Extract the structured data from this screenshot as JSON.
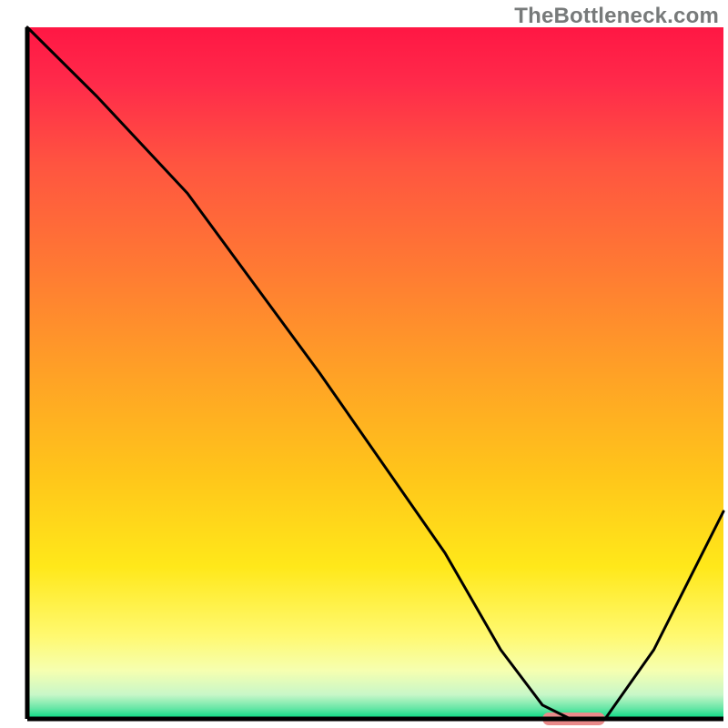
{
  "watermark": "TheBottleneck.com",
  "chart_data": {
    "type": "line",
    "title": "",
    "xlabel": "",
    "ylabel": "",
    "xlim": [
      0,
      100
    ],
    "ylim": [
      0,
      100
    ],
    "x": [
      0,
      10,
      23,
      42,
      60,
      68,
      74,
      78,
      83,
      90,
      100
    ],
    "values": [
      100,
      90,
      76,
      50,
      24,
      10,
      2,
      0,
      0,
      10,
      30
    ],
    "gradient_stops": [
      {
        "offset": 0.0,
        "color": "#ff1744"
      },
      {
        "offset": 0.08,
        "color": "#ff2a4a"
      },
      {
        "offset": 0.2,
        "color": "#ff5540"
      },
      {
        "offset": 0.35,
        "color": "#ff7a33"
      },
      {
        "offset": 0.5,
        "color": "#ffa126"
      },
      {
        "offset": 0.65,
        "color": "#ffc61a"
      },
      {
        "offset": 0.78,
        "color": "#ffe81a"
      },
      {
        "offset": 0.88,
        "color": "#fff970"
      },
      {
        "offset": 0.93,
        "color": "#f6ffb0"
      },
      {
        "offset": 0.965,
        "color": "#c8f7c8"
      },
      {
        "offset": 0.985,
        "color": "#66e6a6"
      },
      {
        "offset": 1.0,
        "color": "#00d980"
      }
    ],
    "marker": {
      "x_start": 74,
      "x_end": 83,
      "y": 0,
      "color": "#e98a8a"
    },
    "line_color": "#000000",
    "line_width": 3
  }
}
